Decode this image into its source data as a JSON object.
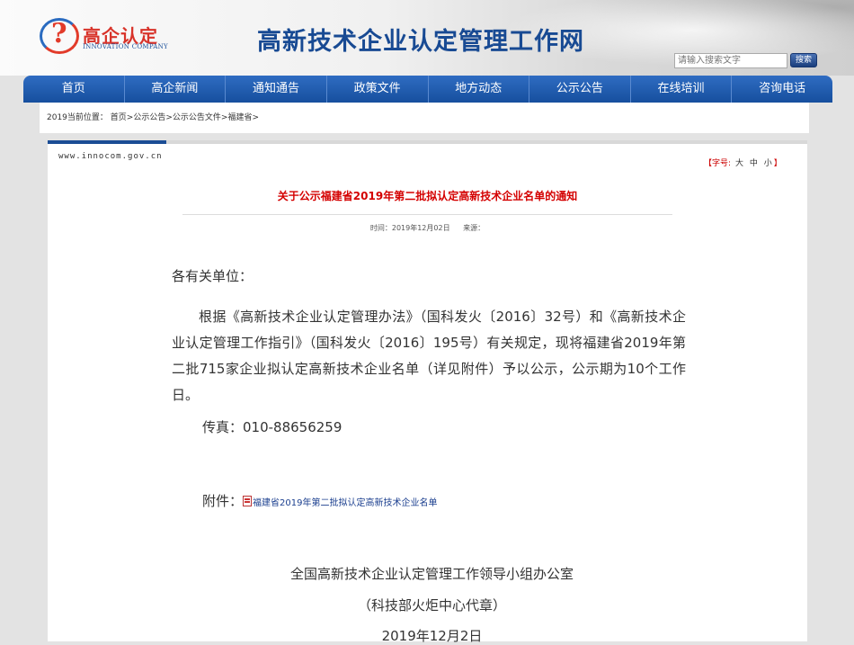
{
  "header": {
    "logo_text": "高企认定",
    "logo_sub": "INNOVATION COMPANY",
    "site_title": "高新技术企业认定管理工作网",
    "search_placeholder": "请输入搜索文字",
    "search_button": "搜索"
  },
  "nav": [
    "首页",
    "高企新闻",
    "通知通告",
    "政策文件",
    "地方动态",
    "公示公告",
    "在线培训",
    "咨询电话"
  ],
  "breadcrumb": {
    "prefix": "2019当前位置：",
    "items": [
      "首页",
      "公示公告",
      "公示公告文件",
      "福建省"
    ],
    "sep": ">"
  },
  "article": {
    "domain": "www.innocom.gov.cn",
    "font_size_label": "字号:",
    "font_sizes": [
      "大",
      "中",
      "小"
    ],
    "title": "关于公示福建省2019年第二批拟认定高新技术企业名单的通知",
    "meta_time": "时间：2019年12月02日",
    "meta_source": "来源：",
    "salutation": "各有关单位：",
    "paragraph": "根据《高新技术企业认定管理办法》（国科发火〔2016〕32号）和《高新技术企业认定管理工作指引》（国科发火〔2016〕195号）有关规定，现将福建省2019年第二批715家企业拟认定高新技术企业名单（详见附件）予以公示，公示期为10个工作日。",
    "fax": "传真：010-88656259",
    "attachment_label": "附件：",
    "attachment_link": "福建省2019年第二批拟认定高新技术企业名单",
    "signature_1": "全国高新技术企业认定管理工作领导小组办公室",
    "signature_2": "（科技部火炬中心代章）",
    "signature_3": "2019年12月2日"
  }
}
